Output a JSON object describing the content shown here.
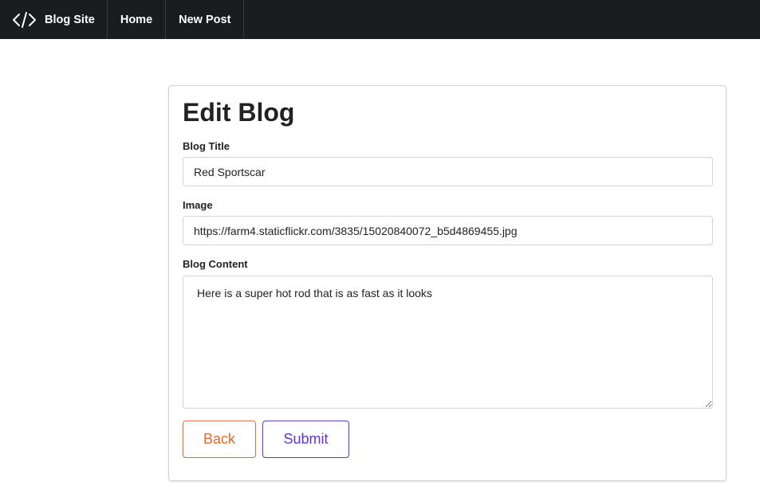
{
  "navbar": {
    "brand_label": "Blog Site",
    "brand_icon": "code-icon",
    "items": [
      {
        "label": "Home"
      },
      {
        "label": "New Post"
      }
    ],
    "background": "#1b1c1d"
  },
  "form": {
    "heading": "Edit Blog",
    "title_label": "Blog Title",
    "title_value": "Red Sportscar",
    "image_label": "Image",
    "image_value": "https://farm4.staticflickr.com/3835/15020840072_b5d4869455.jpg",
    "content_label": "Blog Content",
    "content_value": "Here is a super hot rod that is as fast as it looks",
    "back_label": "Back",
    "submit_label": "Submit"
  },
  "colors": {
    "back_button": "#e8692b",
    "submit_button": "#6435c9"
  }
}
